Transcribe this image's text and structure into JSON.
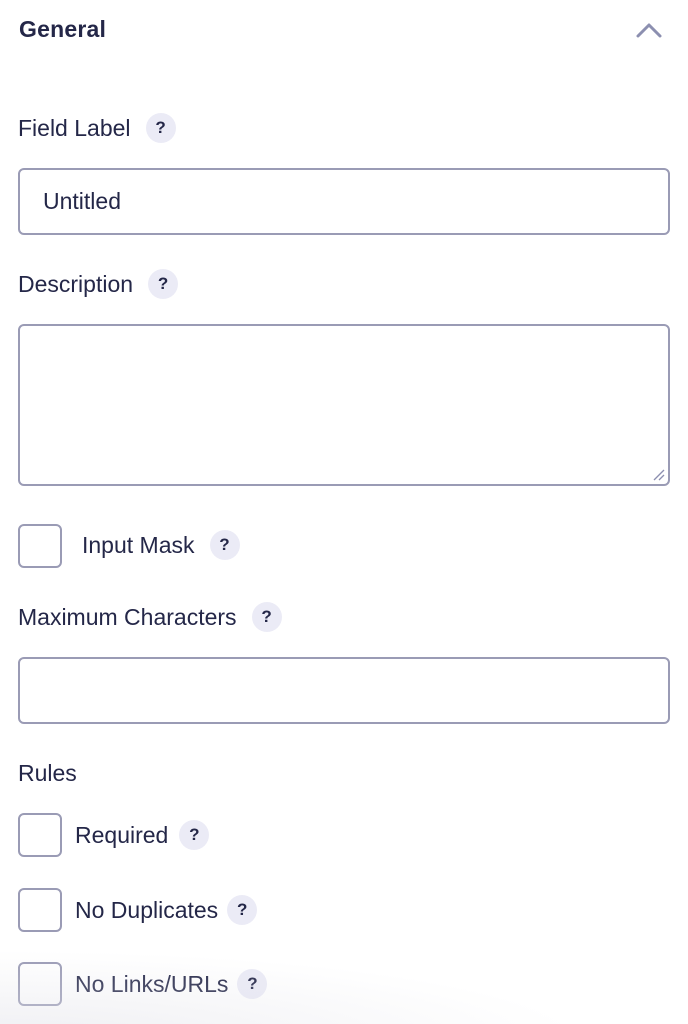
{
  "section": {
    "title": "General",
    "toggle_icon": "chevron-up-icon"
  },
  "help_glyph": "?",
  "field_label": {
    "label": "Field Label",
    "value": "Untitled",
    "placeholder": ""
  },
  "description": {
    "label": "Description",
    "value": ""
  },
  "input_mask": {
    "label": "Input Mask",
    "checked": false
  },
  "max_chars": {
    "label": "Maximum Characters",
    "value": ""
  },
  "rules": {
    "heading": "Rules",
    "items": [
      {
        "label": "Required",
        "checked": false
      },
      {
        "label": "No Duplicates",
        "checked": false
      },
      {
        "label": "No Links/URLs",
        "checked": false
      }
    ]
  },
  "colors": {
    "text": "#242748",
    "border": "#9a9bb5",
    "help_bg": "#ebebf6",
    "chevron": "#8c8fb0"
  }
}
